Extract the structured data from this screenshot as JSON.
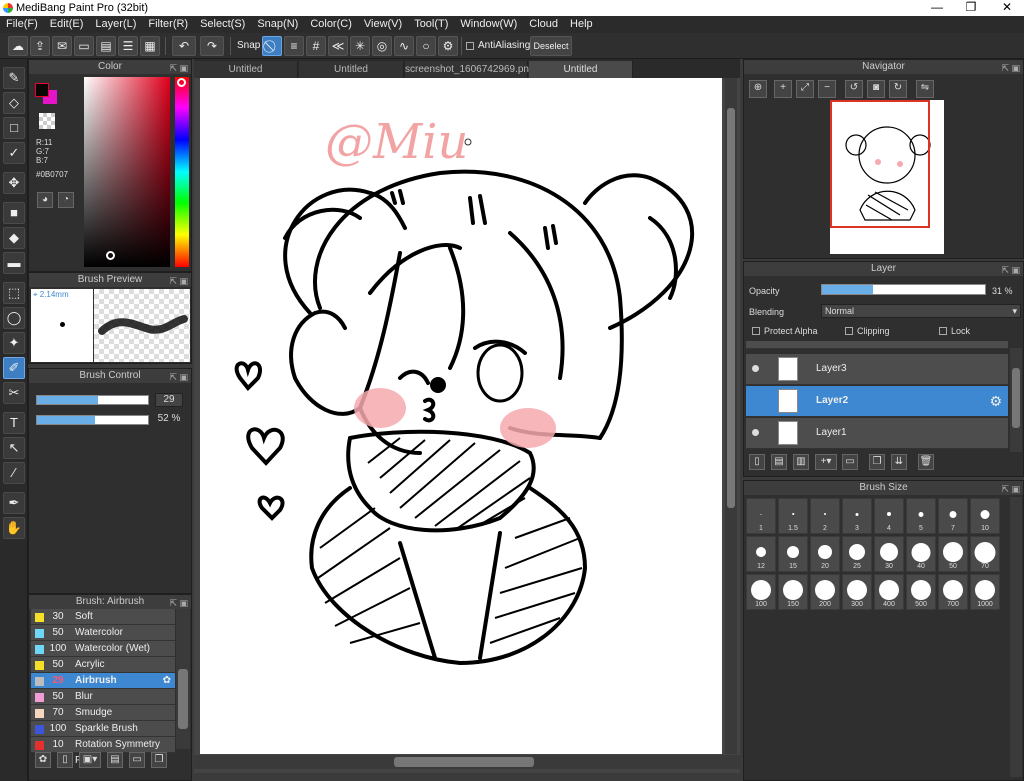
{
  "window": {
    "title": "MediBang Paint Pro (32bit)",
    "min": "—",
    "restore": "❐",
    "close": "✕"
  },
  "menu": [
    "File(F)",
    "Edit(E)",
    "Layer(L)",
    "Filter(R)",
    "Select(S)",
    "Snap(N)",
    "Color(C)",
    "View(V)",
    "Tool(T)",
    "Window(W)",
    "Cloud",
    "Help"
  ],
  "toolbar": {
    "snap_label": "Snap",
    "antialias_label": "AntiAliasing",
    "deselect_label": "Deselect"
  },
  "color_panel": {
    "title": "Color",
    "r": "R:11",
    "g": "G:7",
    "b": "B:7",
    "hex": "#0B0707",
    "fg": "#0b0707",
    "bg": "#e514c9"
  },
  "brush_preview": {
    "title": "Brush Preview",
    "size": "2.14mm"
  },
  "brush_control": {
    "title": "Brush Control",
    "size_value": "29",
    "opacity_value": "52 %",
    "size_fraction": 0.55,
    "opacity_fraction": 0.52
  },
  "brush_list": {
    "title": "Brush: Airbrush",
    "items": [
      {
        "n": "30",
        "name": "Soft",
        "color": "#f5e028"
      },
      {
        "n": "50",
        "name": "Watercolor",
        "color": "#6fd6f5"
      },
      {
        "n": "100",
        "name": "Watercolor (Wet)",
        "color": "#6fd6f5"
      },
      {
        "n": "50",
        "name": "Acrylic",
        "color": "#f5e028"
      },
      {
        "n": "29",
        "name": "Airbrush",
        "color": "#bdbdbd"
      },
      {
        "n": "50",
        "name": "Blur",
        "color": "#f09cd6"
      },
      {
        "n": "70",
        "name": "Smudge",
        "color": "#f7d6c0"
      },
      {
        "n": "100",
        "name": "Sparkle Brush",
        "color": "#3d55d8"
      },
      {
        "n": "10",
        "name": "Rotation Symmetry Pe",
        "color": "#e53030"
      }
    ]
  },
  "tabs": [
    "Untitled",
    "Untitled",
    "screenshot_1606742969.png",
    "Untitled"
  ],
  "canvas": {
    "signature": "@Miu"
  },
  "navigator": {
    "title": "Navigator"
  },
  "layer_panel": {
    "title": "Layer",
    "opacity_label": "Opacity",
    "opacity_value": "31 %",
    "opacity_fraction": 0.31,
    "blending_label": "Blending",
    "blending_value": "Normal",
    "protect_alpha": "Protect Alpha",
    "clipping": "Clipping",
    "lock": "Lock",
    "layers": [
      {
        "name": "Layer3",
        "visible": true,
        "selected": false
      },
      {
        "name": "Layer2",
        "visible": false,
        "selected": true
      },
      {
        "name": "Layer1",
        "visible": true,
        "selected": false
      }
    ]
  },
  "brush_size": {
    "title": "Brush Size",
    "sizes": [
      "1",
      "1.5",
      "2",
      "3",
      "4",
      "5",
      "7",
      "10",
      "12",
      "15",
      "20",
      "25",
      "30",
      "40",
      "50",
      "70",
      "100",
      "150",
      "200",
      "300",
      "400",
      "500",
      "700",
      "1000"
    ]
  }
}
